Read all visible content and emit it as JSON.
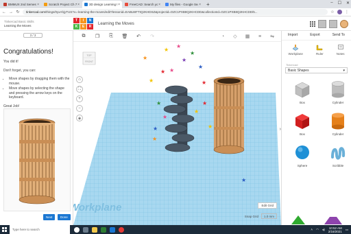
{
  "browser": {
    "tabs": [
      {
        "label": "BMMUX 2nd Semester Digital Ill",
        "color": "#c0392b",
        "active": false
      },
      {
        "label": "Scratch Project Ch 7 Blueprint ",
        "color": "#f39c12",
        "active": false
      },
      {
        "label": "3D design Learning the Moves |",
        "color": "#1b77d2",
        "active": true
      },
      {
        "label": "FreeCAD: Search your portfolio",
        "color": "#e74c3c",
        "active": false
      },
      {
        "label": "My files - Google Search",
        "color": "#4285f4",
        "active": false
      }
    ],
    "new_tab": "+",
    "url_host": "tinkercad.com",
    "url_path": "/things/0yxAhjyTUS?v=-learning-the-moves/edit?lessonid=EABLWFTIQ2KHDSZ&projectid=OZC1PXB8Q2KHCDD&collectionId=OZC1PXB8Q2KHCDD/5...",
    "bookmarks": [
      "Apps",
      "Classroom",
      "Gmail",
      "YouTube",
      "Maps",
      "Drive"
    ]
  },
  "tc": {
    "lesson_context": "Tinkercad Basic Skills",
    "lesson_title": "Learning the Moves",
    "logo_letters": [
      "T",
      "I",
      "N",
      "K",
      "E",
      "R"
    ],
    "logo_colors": [
      "#e2262e",
      "#f7931e",
      "#1b77d2",
      "#4db848",
      "#f7931e",
      "#e2262e"
    ],
    "project_title": "Learning the Moves"
  },
  "lesson": {
    "stepper": "3 / 3",
    "heading": "Congratulations!",
    "p1": "You did it!",
    "p2": "Don't forget, you can:",
    "bullets": [
      "Move shapes by dragging them with the mouse.",
      "Move shapes by selecting the shape and pressing the arrow keys on the keyboard."
    ],
    "p3": "Great Job!",
    "next_label": "Next",
    "done_label": "Done"
  },
  "workplane": {
    "viewcube_top": "TOP",
    "viewcube_front": "FRONT",
    "workplane_label": "Workplane",
    "edit_grid_label": "Edit Grid",
    "snap_grid_label": "Snap Grid",
    "snap_grid_value": "1.0 mm"
  },
  "right_panel": {
    "import_label": "Import",
    "export_label": "Export",
    "send_label": "Send To",
    "workplane_tool": "Workplane",
    "ruler_tool": "Ruler",
    "notes_tool": "Notes",
    "source_tag": "Tinkercad",
    "category_select": "Basic Shapes",
    "shapes": [
      {
        "label": "Box",
        "kind": "box-hole"
      },
      {
        "label": "Cylinder",
        "kind": "cyl-hole"
      },
      {
        "label": "Box",
        "kind": "box-red"
      },
      {
        "label": "Cylinder",
        "kind": "cyl-orange"
      },
      {
        "label": "Sphere",
        "kind": "sphere"
      },
      {
        "label": "Scribble",
        "kind": "scribble"
      }
    ]
  },
  "taskbar": {
    "search_placeholder": "Type here to search",
    "time": "10:52 AM",
    "date": "2/16/2021"
  }
}
